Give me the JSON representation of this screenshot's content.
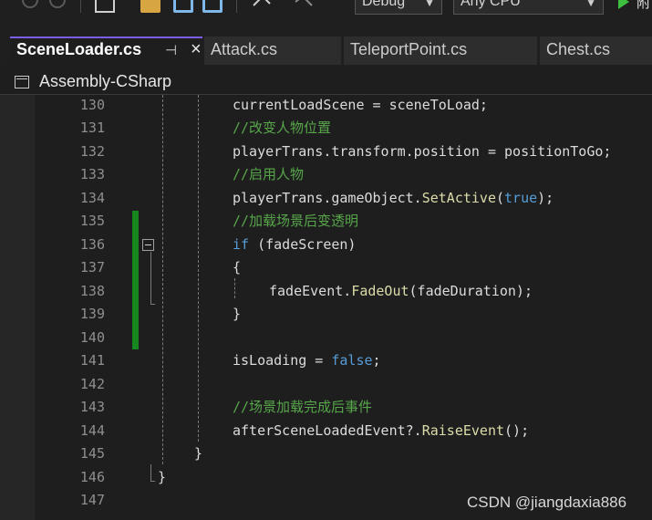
{
  "toolbar": {
    "config_value": "Debug",
    "platform_value": "Any CPU",
    "start_label": "附"
  },
  "tabs": [
    {
      "label": "SceneLoader.cs",
      "active": true
    },
    {
      "label": "Attack.cs"
    },
    {
      "label": "TeleportPoint.cs"
    },
    {
      "label": "Chest.cs"
    }
  ],
  "navbar": {
    "project": "Assembly-CSharp"
  },
  "editor": {
    "lines": [
      {
        "number": "130",
        "text": "currentLoadScene = sceneToLoad;"
      },
      {
        "number": "131",
        "text": "//改变人物位置"
      },
      {
        "number": "132",
        "text": "playerTrans.transform.position = positionToGo;"
      },
      {
        "number": "133",
        "text": "//启用人物"
      },
      {
        "number": "134",
        "text": "playerTrans.gameObject.SetActive(true);"
      },
      {
        "number": "135",
        "text": "//加载场景后变透明"
      },
      {
        "number": "136",
        "text": "if (fadeScreen)"
      },
      {
        "number": "137",
        "text": "{"
      },
      {
        "number": "138",
        "text": "fadeEvent.FadeOut(fadeDuration);"
      },
      {
        "number": "139",
        "text": "}"
      },
      {
        "number": "140",
        "text": ""
      },
      {
        "number": "141",
        "text": "isLoading = false;"
      },
      {
        "number": "142",
        "text": ""
      },
      {
        "number": "143",
        "text": "//场景加载完成后事件"
      },
      {
        "number": "144",
        "text": "afterSceneLoadedEvent?.RaiseEvent();"
      },
      {
        "number": "145",
        "text": "}"
      },
      {
        "number": "146",
        "text": "}"
      },
      {
        "number": "147",
        "text": ""
      }
    ]
  },
  "watermark": "CSDN @jiangdaxia886",
  "colors": {
    "background": "#1e1e1e",
    "comment": "#57a64a",
    "keyword": "#569cd6",
    "method": "#dcdcaa",
    "change_bar": "#17871f",
    "active_tab_accent": "#7b5ee6"
  },
  "icons": [
    "back-icon",
    "forward-icon",
    "multi-file-icon",
    "open-folder-icon",
    "save-icon",
    "save-all-icon",
    "undo-icon",
    "redo-icon",
    "play-icon",
    "pin-icon",
    "close-icon",
    "project-icon",
    "collapse-icon"
  ]
}
